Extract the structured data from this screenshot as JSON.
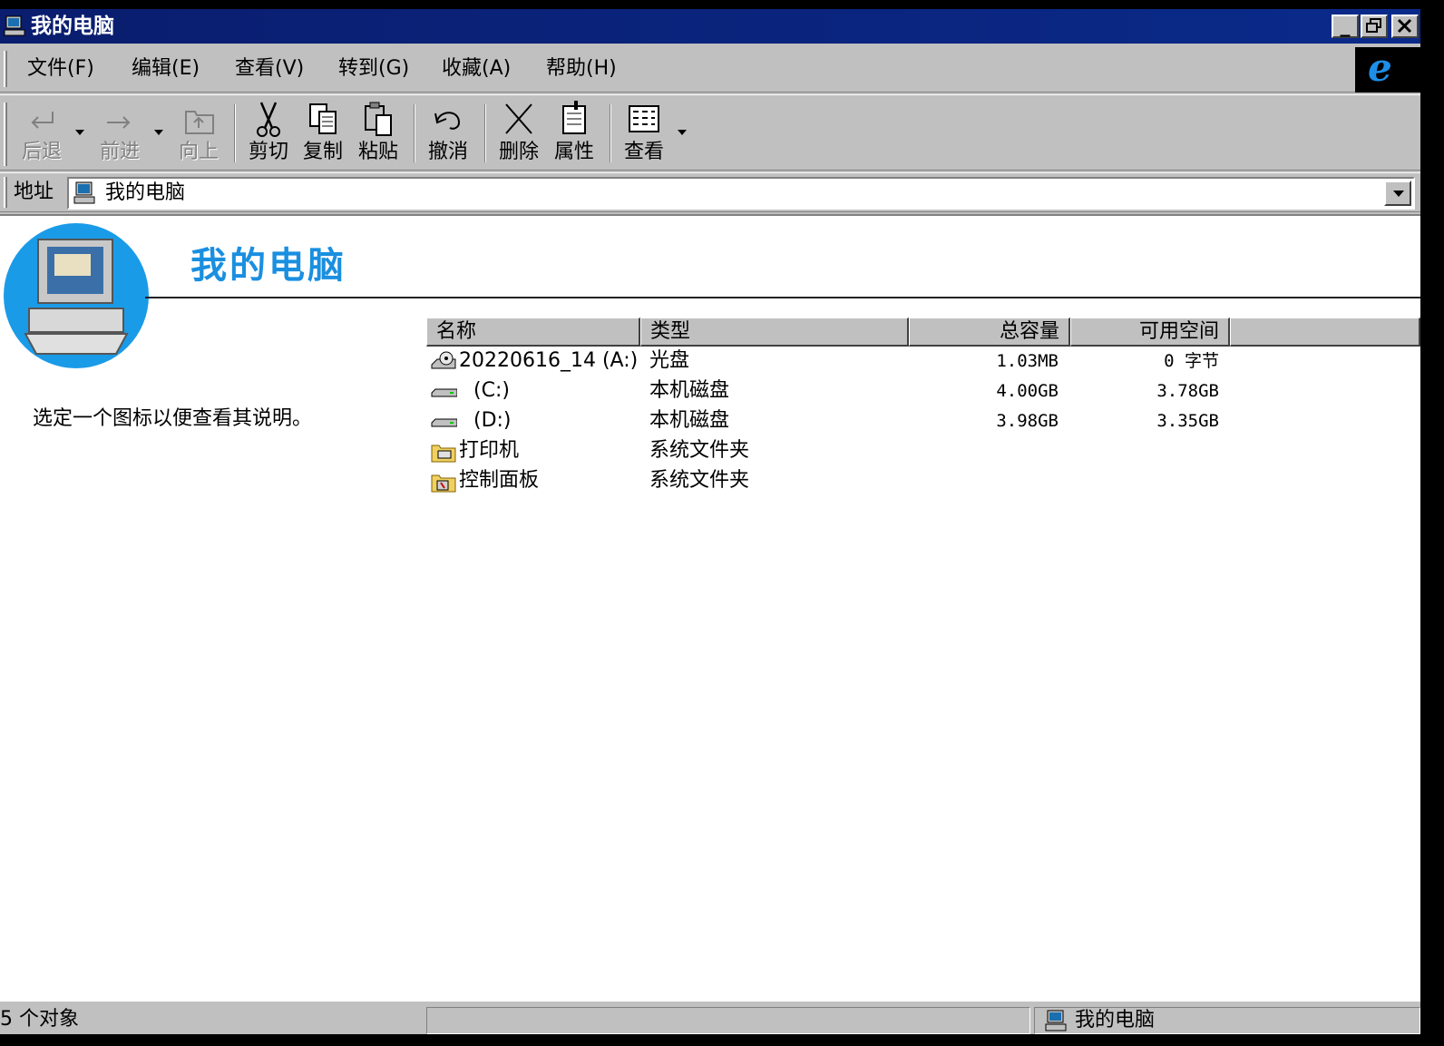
{
  "window": {
    "title": "我的电脑"
  },
  "menu": [
    "文件(F)",
    "编辑(E)",
    "查看(V)",
    "转到(G)",
    "收藏(A)",
    "帮助(H)"
  ],
  "toolbar": {
    "back": "后退",
    "forward": "前进",
    "up": "向上",
    "cut": "剪切",
    "copy": "复制",
    "paste": "粘贴",
    "undo": "撤消",
    "delete": "删除",
    "properties": "属性",
    "views": "查看"
  },
  "address": {
    "label": "地址",
    "value": "我的电脑"
  },
  "content": {
    "title": "我的电脑",
    "info": "选定一个图标以便查看其说明。"
  },
  "columns": {
    "name": "名称",
    "type": "类型",
    "total": "总容量",
    "free": "可用空间"
  },
  "rows": [
    {
      "name": "20220616_14 (A:)",
      "type": "光盘",
      "total": "1.03MB",
      "free": "0 字节",
      "icon": "cdrom-icon"
    },
    {
      "name": "(C:)",
      "type": "本机磁盘",
      "total": "4.00GB",
      "free": "3.78GB",
      "icon": "hard-drive-icon"
    },
    {
      "name": "(D:)",
      "type": "本机磁盘",
      "total": "3.98GB",
      "free": "3.35GB",
      "icon": "hard-drive-icon"
    },
    {
      "name": "打印机",
      "type": "系统文件夹",
      "total": "",
      "free": "",
      "icon": "printers-folder-icon"
    },
    {
      "name": "控制面板",
      "type": "系统文件夹",
      "total": "",
      "free": "",
      "icon": "control-panel-folder-icon"
    }
  ],
  "status": {
    "count": "5 个对象",
    "location": "我的电脑"
  },
  "colors": {
    "titlebar": "#0a2a8a",
    "heading": "#1a8fe0",
    "chrome": "#c0c0c0"
  }
}
